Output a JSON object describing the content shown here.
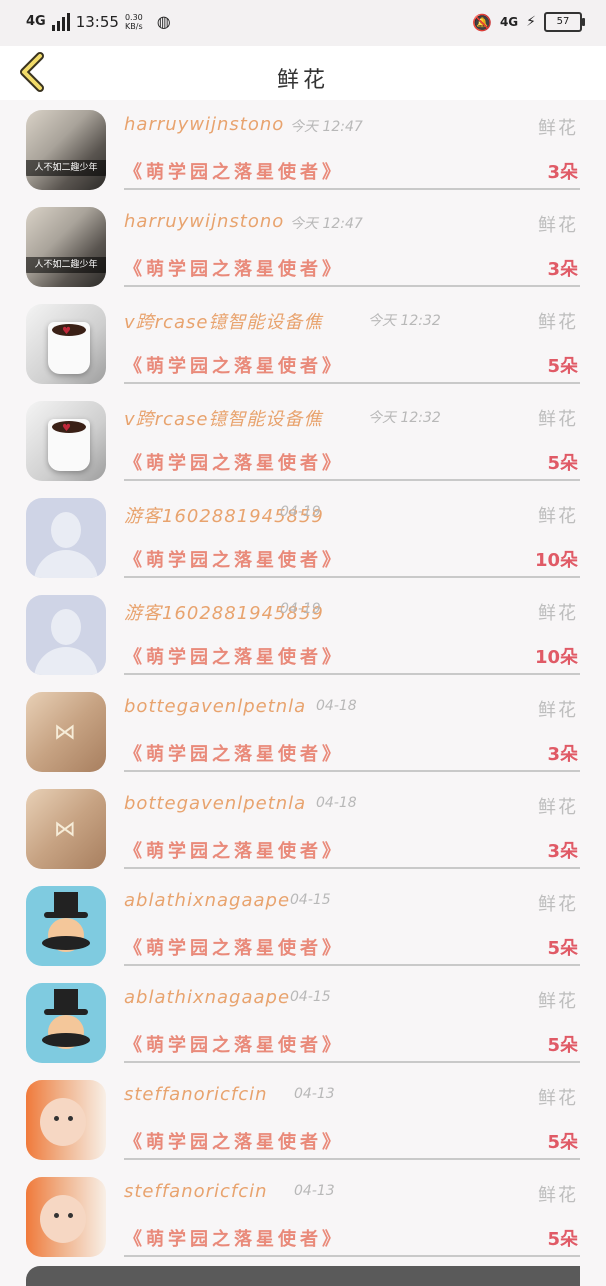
{
  "status_bar": {
    "network": "4G",
    "time": "13:55",
    "speed_value": "0.30",
    "speed_unit": "KB/s",
    "right_network": "4G",
    "battery": "57"
  },
  "header": {
    "title": "鲜花"
  },
  "records": [
    {
      "user": "harruywijnstono",
      "time": "今天 12:47",
      "type": "鲜花",
      "gift": "《萌学园之落星使者》",
      "count": "3朵",
      "avatar": "photo",
      "caption": "人不如二趣少年"
    },
    {
      "user": "harruywijnstono",
      "time": "今天 12:47",
      "type": "鲜花",
      "gift": "《萌学园之落星使者》",
      "count": "3朵",
      "avatar": "photo",
      "caption": "人不如二趣少年"
    },
    {
      "user": "v跨rcase镱智能设备僬",
      "time": "今天 12:32",
      "type": "鲜花",
      "gift": "《萌学园之落星使者》",
      "count": "5朵",
      "avatar": "cup"
    },
    {
      "user": "v跨rcase镱智能设备僬",
      "time": "今天 12:32",
      "type": "鲜花",
      "gift": "《萌学园之落星使者》",
      "count": "5朵",
      "avatar": "cup"
    },
    {
      "user": "游客1602881945859",
      "time": "04-19",
      "type": "鲜花",
      "gift": "《萌学园之落星使者》",
      "count": "10朵",
      "avatar": "guest"
    },
    {
      "user": "游客1602881945859",
      "time": "04-19",
      "type": "鲜花",
      "gift": "《萌学园之落星使者》",
      "count": "10朵",
      "avatar": "guest"
    },
    {
      "user": "bottegavenlpetnla",
      "time": "04-18",
      "type": "鲜花",
      "gift": "《萌学园之落星使者》",
      "count": "3朵",
      "avatar": "case"
    },
    {
      "user": "bottegavenlpetnla",
      "time": "04-18",
      "type": "鲜花",
      "gift": "《萌学园之落星使者》",
      "count": "3朵",
      "avatar": "case"
    },
    {
      "user": "ablathixnagaape",
      "time": "04-15",
      "type": "鲜花",
      "gift": "《萌学园之落星使者》",
      "count": "5朵",
      "avatar": "hat"
    },
    {
      "user": "ablathixnagaape",
      "time": "04-15",
      "type": "鲜花",
      "gift": "《萌学园之落星使者》",
      "count": "5朵",
      "avatar": "hat"
    },
    {
      "user": "steffanoricfcin",
      "time": "04-13",
      "type": "鲜花",
      "gift": "《萌学园之落星使者》",
      "count": "5朵",
      "avatar": "baby"
    },
    {
      "user": "steffanoricfcin",
      "time": "04-13",
      "type": "鲜花",
      "gift": "《萌学园之落星使者》",
      "count": "5朵",
      "avatar": "baby"
    }
  ]
}
